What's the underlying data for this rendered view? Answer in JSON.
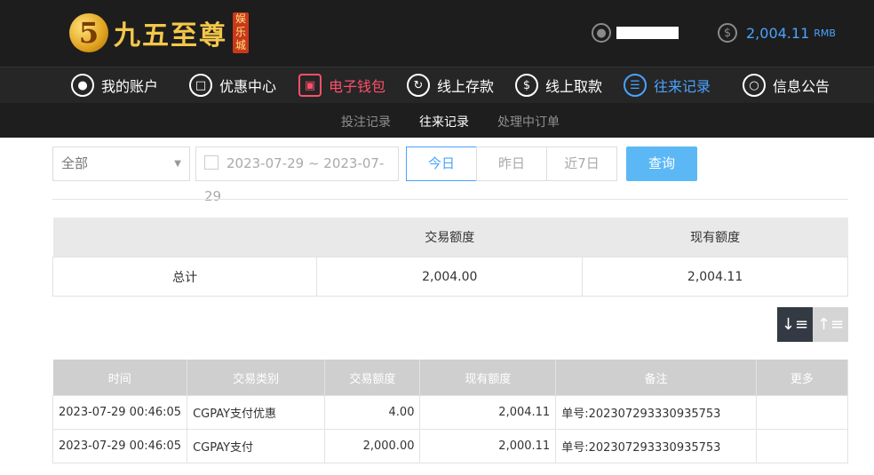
{
  "header": {
    "logo_mark": "5",
    "logo_text": "九五至尊",
    "logo_tag": "娱乐城",
    "balance": "2,004.11",
    "balance_unit": "RMB",
    "user_icon": "user-icon",
    "coin_icon": "dollar-coin-icon"
  },
  "nav": {
    "items": [
      {
        "label": "我的账户",
        "icon": "user-icon"
      },
      {
        "label": "优惠中心",
        "icon": "gift-icon"
      },
      {
        "label": "电子钱包",
        "icon": "wallet-icon"
      },
      {
        "label": "线上存款",
        "icon": "deposit-icon"
      },
      {
        "label": "线上取款",
        "icon": "withdraw-icon"
      },
      {
        "label": "往来记录",
        "icon": "records-icon"
      },
      {
        "label": "信息公告",
        "icon": "bell-icon"
      }
    ]
  },
  "subnav": {
    "tabs": [
      "投注记录",
      "往来记录",
      "处理中订单"
    ],
    "active": "往来记录"
  },
  "filters": {
    "type_select": "全部",
    "date_range": "2023-07-29 ~ 2023-07-29",
    "quick": [
      "今日",
      "昨日",
      "近7日"
    ],
    "quick_active": "今日",
    "query_label": "查询"
  },
  "summary": {
    "headers": [
      "",
      "交易额度",
      "现有额度"
    ],
    "row": [
      "总计",
      "2,004.00",
      "2,004.11"
    ]
  },
  "records": {
    "headers": [
      "时间",
      "交易类别",
      "交易额度",
      "现有额度",
      "备注",
      "更多"
    ],
    "rows": [
      [
        "2023-07-29 00:46:05",
        "CGPAY支付优惠",
        "4.00",
        "2,004.11",
        "单号:202307293330935753",
        ""
      ],
      [
        "2023-07-29 00:46:05",
        "CGPAY支付",
        "2,000.00",
        "2,000.11",
        "单号:202307293330935753",
        ""
      ]
    ]
  },
  "colors": {
    "accent_blue": "#4aa3ff",
    "accent_red": "#ff4f6a",
    "header_bg": "#1d1d1d",
    "query_button": "#5cb8f5"
  }
}
